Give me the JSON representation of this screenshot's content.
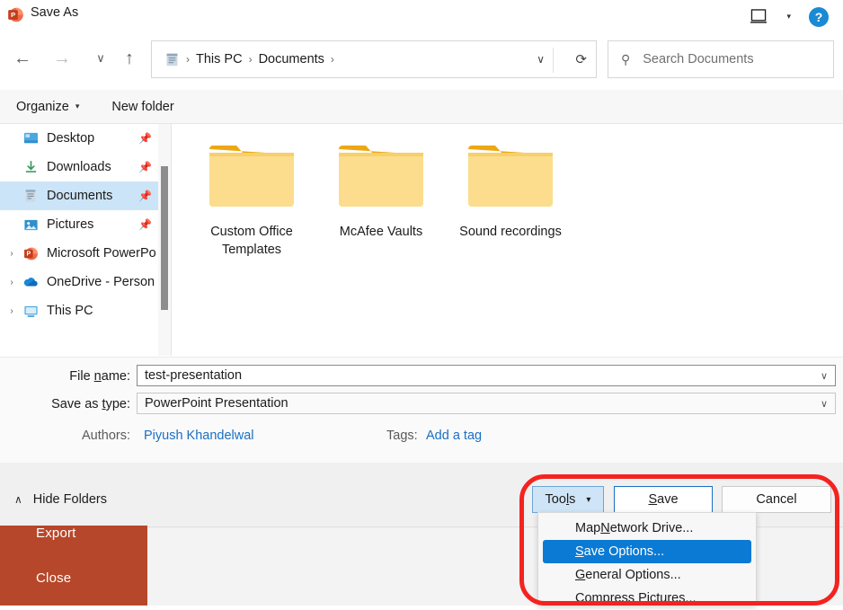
{
  "window": {
    "title": "Save As",
    "app_icon": "powerpoint-icon",
    "close_label": "✕"
  },
  "nav": {
    "back": "←",
    "forward": "→",
    "recent": "∨",
    "up": "↑",
    "breadcrumb": {
      "icon": "documents-icon",
      "items": [
        "This PC",
        "Documents"
      ],
      "separator": "›",
      "trailing_separator": "›",
      "caret": "∨",
      "refresh": "⟳"
    }
  },
  "search": {
    "icon": "search-icon",
    "placeholder": "Search Documents",
    "value": ""
  },
  "commandbar": {
    "organize": "Organize",
    "organize_caret": "▾",
    "new_folder": "New folder",
    "view_icon": "view-layout-icon",
    "view_caret": "▾",
    "help": "?"
  },
  "sidebar": {
    "items": [
      {
        "label": "Desktop",
        "icon": "desktop-icon",
        "pinned": true,
        "expander": "",
        "selected": false
      },
      {
        "label": "Downloads",
        "icon": "download-icon",
        "pinned": true,
        "expander": "",
        "selected": false
      },
      {
        "label": "Documents",
        "icon": "documents-icon",
        "pinned": true,
        "expander": "",
        "selected": true
      },
      {
        "label": "Pictures",
        "icon": "pictures-icon",
        "pinned": true,
        "expander": "",
        "selected": false
      },
      {
        "label": "Microsoft PowerPo",
        "icon": "powerpoint-icon",
        "pinned": false,
        "expander": "›",
        "selected": false
      },
      {
        "label": "OneDrive - Person",
        "icon": "onedrive-icon",
        "pinned": false,
        "expander": "›",
        "selected": false
      },
      {
        "label": "This PC",
        "icon": "thispc-icon",
        "pinned": false,
        "expander": "›",
        "selected": false
      }
    ],
    "pin_glyph": "📌"
  },
  "files": [
    {
      "name": "Custom Office Templates",
      "icon": "folder-icon"
    },
    {
      "name": "McAfee Vaults",
      "icon": "folder-icon"
    },
    {
      "name": "Sound recordings",
      "icon": "folder-icon"
    }
  ],
  "form": {
    "filename_label_pre": "File ",
    "filename_label_key": "n",
    "filename_label_post": "ame:",
    "filename_value": "test-presentation",
    "savetype_label_pre": "Save as ",
    "savetype_label_key": "t",
    "savetype_label_post": "ype:",
    "savetype_value": "PowerPoint Presentation",
    "caret": "∨",
    "authors_label": "Authors:",
    "authors_value": "Piyush Khandelwal",
    "tags_label": "Tags:",
    "tags_value": "Add a tag"
  },
  "footer": {
    "hide_folders": "Hide Folders",
    "hide_folders_caret": "∧",
    "tools_label": "Tools",
    "tools_caret": "▾",
    "save_pre": "",
    "save_key": "S",
    "save_post": "ave",
    "cancel_label": "Cancel"
  },
  "tools_menu": [
    {
      "pre": "Map ",
      "key": "N",
      "post": "etwork Drive...",
      "highlighted": false
    },
    {
      "pre": "",
      "key": "S",
      "post": "ave Options...",
      "highlighted": true
    },
    {
      "pre": "",
      "key": "G",
      "post": "eneral Options...",
      "highlighted": false
    },
    {
      "pre": "",
      "key": "C",
      "post": "ompress Pictures...",
      "highlighted": false
    }
  ],
  "backstage": {
    "export": "Export",
    "close": "Close"
  },
  "colors": {
    "powerpoint_orange": "#b7472a",
    "annotation_red": "#f4231f",
    "menu_highlight_blue": "#0a7ad4",
    "selection_blue": "#cce4f7",
    "link_blue": "#1a6fc4",
    "folder_yellow": "#fcd25f"
  }
}
